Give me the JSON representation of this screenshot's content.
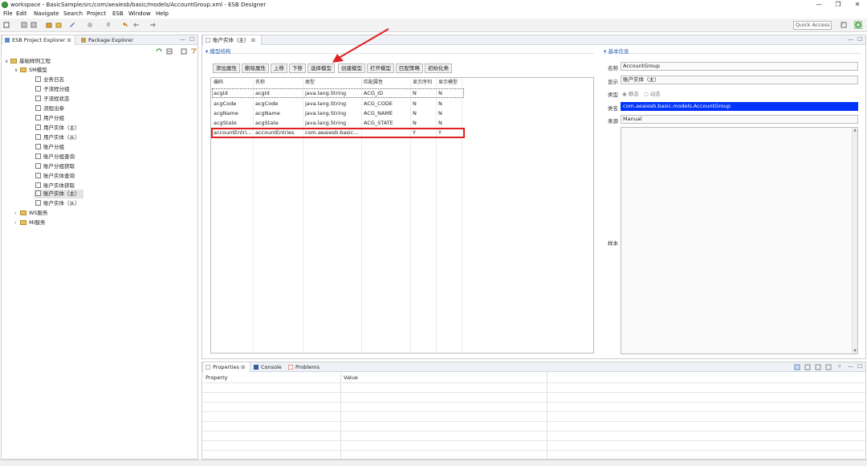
{
  "window": {
    "title": "workspace - BasicSample/src/com/aeaiesb/basic/models/AccountGroup.xml - ESB Designer",
    "minimize": "—",
    "restore": "❐",
    "close": "✕"
  },
  "menu": [
    "File",
    "Edit",
    "Navigate",
    "Search",
    "Project",
    "ESB",
    "Window",
    "Help"
  ],
  "toolbar": {
    "quick_access": "Quick Access"
  },
  "explorer": {
    "tab_project": "ESB Project Explorer",
    "tab_package": "Package Explorer",
    "project": "基础样例工程",
    "sm_folder": "SM模型",
    "sm_items": [
      "业务日志",
      "子流程分组",
      "子流程状态",
      "流程出参",
      "用户分组",
      "用户实体（主）",
      "用户实体（从）",
      "账户分组",
      "账户分组查询",
      "账户分组获取",
      "账户实体查询",
      "账户实体获取",
      "账户实体（主）",
      "账户实体（从）"
    ],
    "ws_folder": "WS服务",
    "mi_folder": "MI服务"
  },
  "editor": {
    "tab": "账户实体（主）",
    "section_title": "模型结构",
    "buttons": [
      "添加属性",
      "删除属性",
      "上移",
      "下移",
      "选择模型",
      "创建模型",
      "打开模型",
      "匹配策略",
      "初始化类"
    ],
    "columns": [
      "编码",
      "名称",
      "类型",
      "匹配属性",
      "显示序列",
      "显示模型"
    ],
    "rows": [
      [
        "acgId",
        "acgId",
        "java.lang.String",
        "ACG_ID",
        "N",
        "N"
      ],
      [
        "acgCode",
        "acgCode",
        "java.lang.String",
        "ACG_CODE",
        "N",
        "N"
      ],
      [
        "acgName",
        "acgName",
        "java.lang.String",
        "ACG_NAME",
        "N",
        "N"
      ],
      [
        "acgState",
        "acgState",
        "java.lang.String",
        "ACG_STATE",
        "N",
        "N"
      ],
      [
        "accountEntri...",
        "accountEntries",
        "com.aeaiesb.basic...",
        "",
        "Y",
        "Y"
      ]
    ]
  },
  "basic_info": {
    "section_title": "基本信息",
    "name_label": "名称",
    "name_value": "AccountGroup",
    "display_label": "显示",
    "display_value": "账户实体（主）",
    "type_label": "类型",
    "type_static": "静态",
    "type_dynamic": "动态",
    "class_label": "类名",
    "class_value": "com.aeaiesb.basic.models.AccountGroup",
    "source_label": "来源",
    "source_value": "Manual",
    "sample_label": "样本"
  },
  "bottom": {
    "tab_properties": "Properties",
    "tab_console": "Console",
    "tab_problems": "Problems",
    "col_property": "Property",
    "col_value": "Value"
  },
  "colors": {
    "highlight_red": "#e02020",
    "selection_blue": "#0033ff",
    "section_blue": "#2a5db0"
  }
}
